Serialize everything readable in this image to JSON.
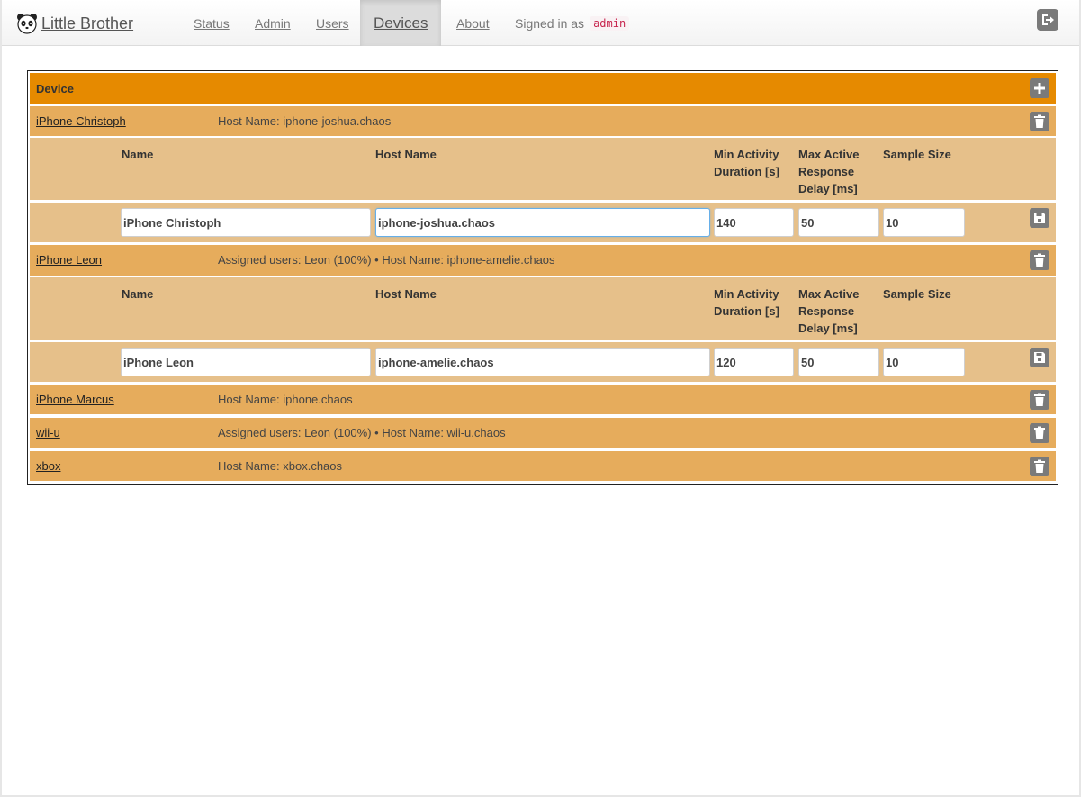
{
  "navbar": {
    "brand": "Little Brother",
    "items": [
      {
        "label": "Status"
      },
      {
        "label": "Admin"
      },
      {
        "label": "Users"
      },
      {
        "label": "Devices",
        "active": true
      },
      {
        "label": "About"
      }
    ],
    "signed_in_prefix": "Signed in as",
    "user": "admin",
    "logout_icon": "logout-icon"
  },
  "table": {
    "header": "Device",
    "add_icon": "plus-icon",
    "columns": {
      "name": "Name",
      "host": "Host Name",
      "min_activity": "Min Activity Duration [s]",
      "max_delay": "Max Active Response Delay [ms]",
      "sample": "Sample Size"
    },
    "devices": [
      {
        "name": "iPhone Christoph",
        "info": "Host Name: iphone-joshua.chaos",
        "expanded": true,
        "form": {
          "name": "iPhone Christoph",
          "host": "iphone-joshua.chaos",
          "min_activity": "140",
          "max_delay": "50",
          "sample": "10"
        }
      },
      {
        "name": "iPhone Leon",
        "info": "Assigned users: Leon (100%) • Host Name: iphone-amelie.chaos",
        "expanded": true,
        "form": {
          "name": "iPhone Leon",
          "host": "iphone-amelie.chaos",
          "min_activity": "120",
          "max_delay": "50",
          "sample": "10"
        }
      },
      {
        "name": "iPhone Marcus",
        "info": "Host Name: iphone.chaos"
      },
      {
        "name": "wii-u",
        "info": "Assigned users: Leon (100%) • Host Name: wii-u.chaos"
      },
      {
        "name": "xbox",
        "info": "Host Name: xbox.chaos"
      }
    ]
  },
  "colors": {
    "header": "#e68a00",
    "device_row": "#e6ac5c",
    "detail_row": "#e6c08a",
    "icon_button": "#7a7a7a"
  }
}
